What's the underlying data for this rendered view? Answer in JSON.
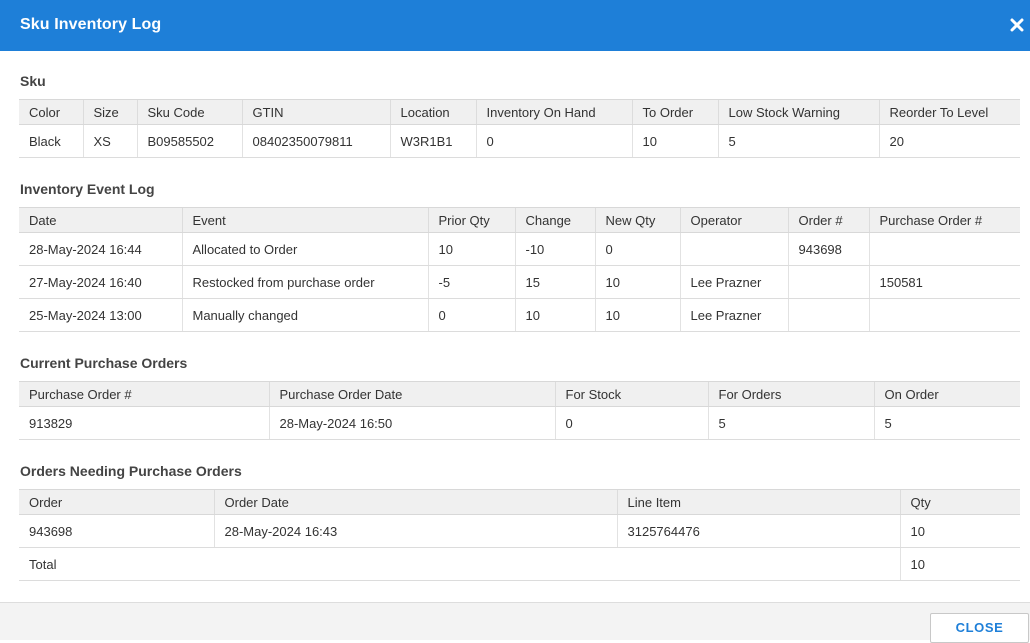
{
  "dialog": {
    "title": "Sku Inventory Log",
    "close_label": "CLOSE"
  },
  "sku": {
    "section_title": "Sku",
    "columns": [
      "Color",
      "Size",
      "Sku Code",
      "GTIN",
      "Location",
      "Inventory On Hand",
      "To Order",
      "Low Stock Warning",
      "Reorder To Level"
    ],
    "rows": [
      [
        "Black",
        "XS",
        "B09585502",
        "08402350079811",
        "W3R1B1",
        "0",
        "10",
        "5",
        "20"
      ]
    ]
  },
  "event_log": {
    "section_title": "Inventory Event Log",
    "columns": [
      "Date",
      "Event",
      "Prior Qty",
      "Change",
      "New Qty",
      "Operator",
      "Order #",
      "Purchase Order #"
    ],
    "rows": [
      [
        "28-May-2024 16:44",
        "Allocated to Order",
        "10",
        "-10",
        "0",
        "",
        "943698",
        ""
      ],
      [
        "27-May-2024 16:40",
        "Restocked from purchase order",
        "-5",
        "15",
        "10",
        "Lee Prazner",
        "",
        "150581"
      ],
      [
        "25-May-2024 13:00",
        "Manually changed",
        "0",
        "10",
        "10",
        "Lee Prazner",
        "",
        ""
      ]
    ]
  },
  "purchase_orders": {
    "section_title": "Current Purchase Orders",
    "columns": [
      "Purchase Order #",
      "Purchase Order Date",
      "For Stock",
      "For Orders",
      "On Order"
    ],
    "rows": [
      [
        "913829",
        "28-May-2024 16:50",
        "0",
        "5",
        "5"
      ]
    ]
  },
  "orders_needing": {
    "section_title": "Orders Needing Purchase Orders",
    "columns": [
      "Order",
      "Order Date",
      "Line Item",
      "Qty"
    ],
    "rows": [
      [
        "943698",
        "28-May-2024 16:43",
        "3125764476",
        "10"
      ]
    ],
    "total_label": "Total",
    "total_qty": "10"
  }
}
